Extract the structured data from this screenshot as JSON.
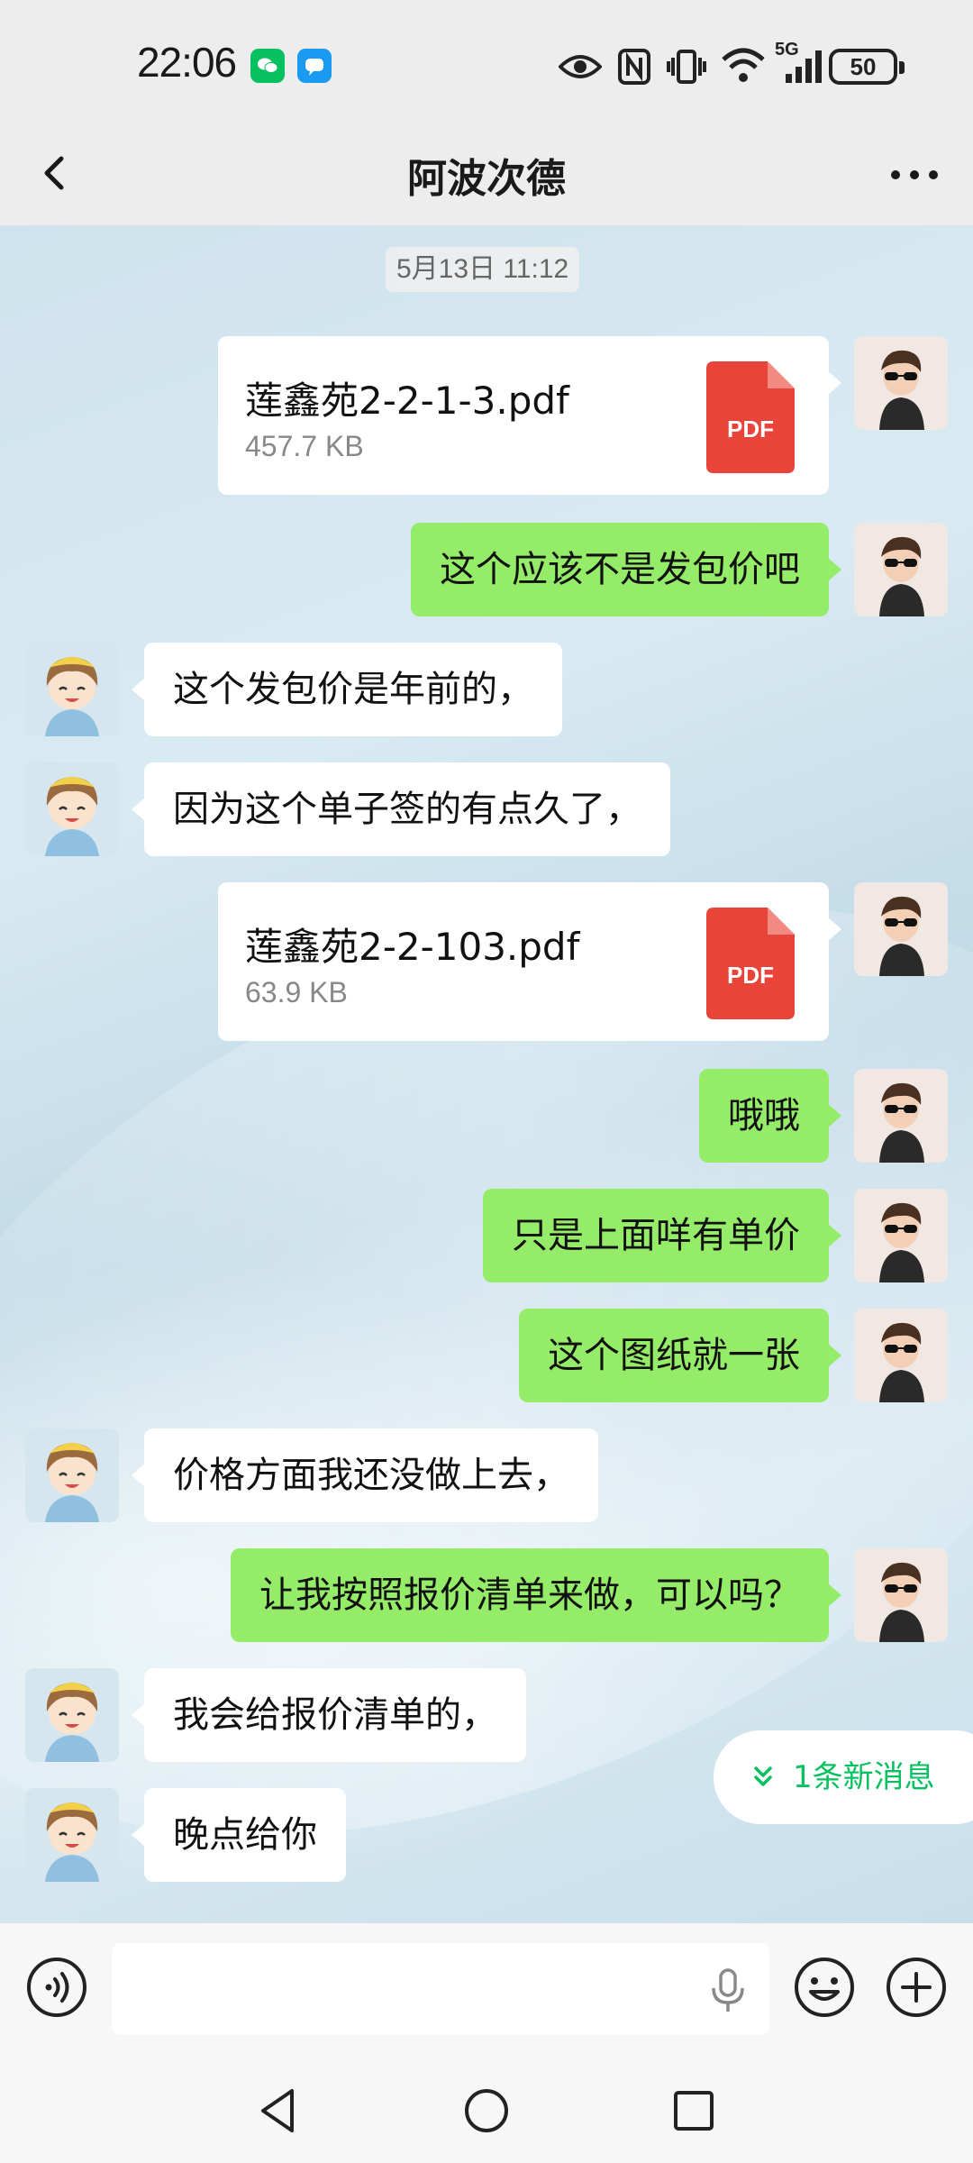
{
  "status_bar": {
    "time": "22:06",
    "network": "5G",
    "battery": "50",
    "icons": [
      "wechat-icon",
      "message-icon",
      "eye-icon",
      "nfc-icon",
      "vibrate-icon",
      "wifi-icon",
      "signal-icon",
      "battery-icon"
    ]
  },
  "header": {
    "title": "阿波次德",
    "back_icon": "chevron-left-icon",
    "more_icon": "more-dots-icon"
  },
  "chat": {
    "timestamp": "5月13日 11:12",
    "messages": [
      {
        "from": "me",
        "type": "file",
        "file_name": "莲鑫苑2-2-1-3.pdf",
        "file_size": "457.7 KB",
        "file_type": "PDF"
      },
      {
        "from": "me",
        "type": "text",
        "text": "这个应该不是发包价吧"
      },
      {
        "from": "them",
        "type": "text",
        "text": "这个发包价是年前的，"
      },
      {
        "from": "them",
        "type": "text",
        "text": "因为这个单子签的有点久了，"
      },
      {
        "from": "me",
        "type": "file",
        "file_name": "莲鑫苑2-2-103.pdf",
        "file_size": "63.9 KB",
        "file_type": "PDF"
      },
      {
        "from": "me",
        "type": "text",
        "text": "哦哦"
      },
      {
        "from": "me",
        "type": "text",
        "text": "只是上面咩有单价"
      },
      {
        "from": "me",
        "type": "text",
        "text": "这个图纸就一张"
      },
      {
        "from": "them",
        "type": "text",
        "text": "价格方面我还没做上去，"
      },
      {
        "from": "me",
        "type": "text",
        "text": "让我按照报价清单来做，可以吗？"
      },
      {
        "from": "them",
        "type": "text",
        "text": "我会给报价清单的，"
      },
      {
        "from": "them",
        "type": "text",
        "text": "晚点给你"
      }
    ],
    "new_message_hint": "1条新消息"
  },
  "input_bar": {
    "text_value": "",
    "icons": [
      "voice-icon",
      "mic-icon",
      "emoji-icon",
      "plus-icon"
    ]
  },
  "nav_bar": {
    "icons": [
      "nav-back-icon",
      "nav-home-icon",
      "nav-recent-icon"
    ]
  },
  "colors": {
    "my_bubble": "#95ec69",
    "their_bubble": "#ffffff",
    "accent": "#07c160",
    "pdf_red": "#e8443a"
  }
}
